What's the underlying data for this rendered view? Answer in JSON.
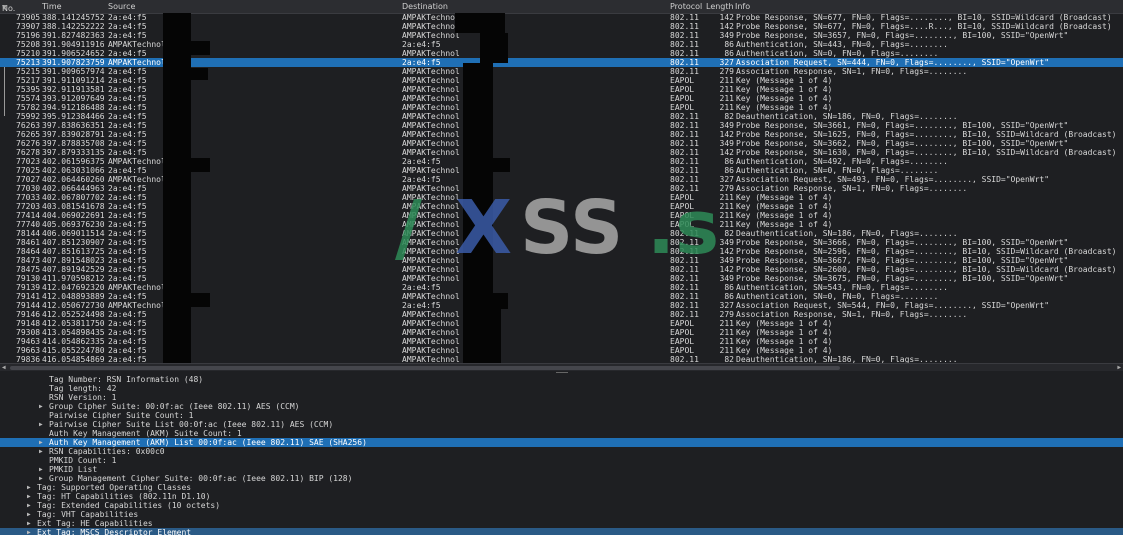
{
  "columns": [
    {
      "key": "no",
      "label": "No."
    },
    {
      "key": "time",
      "label": "Time"
    },
    {
      "key": "source",
      "label": "Source"
    },
    {
      "key": "destination",
      "label": "Destination"
    },
    {
      "key": "protocol",
      "label": "Protocol"
    },
    {
      "key": "length",
      "label": "Length"
    },
    {
      "key": "info",
      "label": "Info"
    }
  ],
  "selected_packet_index": 5,
  "packets": [
    {
      "no": "73905",
      "time": "388.141245752",
      "source": "2a:e4:f5",
      "destination": "AMPAKTechnol",
      "protocol": "802.11",
      "length": "142",
      "info": "Probe Response, SN=677, FN=0, Flags=........, BI=10, SSID=Wildcard (Broadcast)"
    },
    {
      "no": "73907",
      "time": "388.142252222",
      "source": "2a:e4:f5",
      "destination": "AMPAKTechnol",
      "protocol": "802.11",
      "length": "142",
      "info": "Probe Response, SN=677, FN=0, Flags=....R..., BI=10, SSID=Wildcard (Broadcast)"
    },
    {
      "no": "75196",
      "time": "391.827482363",
      "source": "2a:e4:f5",
      "destination": "AMPAKTechnol",
      "protocol": "802.11",
      "length": "349",
      "info": "Probe Response, SN=3657, FN=0, Flags=........, BI=100, SSID=\"OpenWrt\""
    },
    {
      "no": "75208",
      "time": "391.904911916",
      "source": "AMPAKTechnol",
      "destination": "2a:e4:f5",
      "protocol": "802.11",
      "length": "86",
      "info": "Authentication, SN=443, FN=0, Flags=........"
    },
    {
      "no": "75210",
      "time": "391.906524652",
      "source": "2a:e4:f5",
      "destination": "AMPAKTechnol",
      "protocol": "802.11",
      "length": "86",
      "info": "Authentication, SN=0, FN=0, Flags=........"
    },
    {
      "no": "75213",
      "time": "391.907823759",
      "source": "AMPAKTechnol",
      "destination": "2a:e4:f5",
      "protocol": "802.11",
      "length": "327",
      "info": "Association Request, SN=444, FN=0, Flags=........, SSID=\"OpenWrt\""
    },
    {
      "no": "75215",
      "time": "391.909657974",
      "source": "2a:e4:f5",
      "destination": "AMPAKTechnol",
      "protocol": "802.11",
      "length": "279",
      "info": "Association Response, SN=1, FN=0, Flags=........"
    },
    {
      "no": "75217",
      "time": "391.911091214",
      "source": "2a:e4:f5",
      "destination": "AMPAKTechnol",
      "protocol": "EAPOL",
      "length": "211",
      "info": "Key (Message 1 of 4)"
    },
    {
      "no": "75395",
      "time": "392.911913581",
      "source": "2a:e4:f5",
      "destination": "AMPAKTechnol",
      "protocol": "EAPOL",
      "length": "211",
      "info": "Key (Message 1 of 4)"
    },
    {
      "no": "75574",
      "time": "393.912097649",
      "source": "2a:e4:f5",
      "destination": "AMPAKTechnol",
      "protocol": "EAPOL",
      "length": "211",
      "info": "Key (Message 1 of 4)"
    },
    {
      "no": "75782",
      "time": "394.912186488",
      "source": "2a:e4:f5",
      "destination": "AMPAKTechnol",
      "protocol": "EAPOL",
      "length": "211",
      "info": "Key (Message 1 of 4)"
    },
    {
      "no": "75992",
      "time": "395.912384466",
      "source": "2a:e4:f5",
      "destination": "AMPAKTechnol",
      "protocol": "802.11",
      "length": "82",
      "info": "Deauthentication, SN=186, FN=0, Flags=........"
    },
    {
      "no": "76263",
      "time": "397.838636351",
      "source": "2a:e4:f5",
      "destination": "AMPAKTechnol",
      "protocol": "802.11",
      "length": "349",
      "info": "Probe Response, SN=3661, FN=0, Flags=........, BI=100, SSID=\"OpenWrt\""
    },
    {
      "no": "76265",
      "time": "397.839028791",
      "source": "2a:e4:f5",
      "destination": "AMPAKTechnol",
      "protocol": "802.11",
      "length": "142",
      "info": "Probe Response, SN=1625, FN=0, Flags=........, BI=10, SSID=Wildcard (Broadcast)"
    },
    {
      "no": "76276",
      "time": "397.878835708",
      "source": "2a:e4:f5",
      "destination": "AMPAKTechnol",
      "protocol": "802.11",
      "length": "349",
      "info": "Probe Response, SN=3662, FN=0, Flags=........, BI=100, SSID=\"OpenWrt\""
    },
    {
      "no": "76278",
      "time": "397.879333135",
      "source": "2a:e4:f5",
      "destination": "AMPAKTechnol",
      "protocol": "802.11",
      "length": "142",
      "info": "Probe Response, SN=1630, FN=0, Flags=........, BI=10, SSID=Wildcard (Broadcast)"
    },
    {
      "no": "77023",
      "time": "402.061596375",
      "source": "AMPAKTechnol",
      "destination": "2a:e4:f5",
      "protocol": "802.11",
      "length": "86",
      "info": "Authentication, SN=492, FN=0, Flags=........"
    },
    {
      "no": "77025",
      "time": "402.063031066",
      "source": "2a:e4:f5",
      "destination": "AMPAKTechnol",
      "protocol": "802.11",
      "length": "86",
      "info": "Authentication, SN=0, FN=0, Flags=........"
    },
    {
      "no": "77027",
      "time": "402.064460260",
      "source": "AMPAKTechnol",
      "destination": "2a:e4:f5",
      "protocol": "802.11",
      "length": "327",
      "info": "Association Request, SN=493, FN=0, Flags=........, SSID=\"OpenWrt\""
    },
    {
      "no": "77030",
      "time": "402.066444963",
      "source": "2a:e4:f5",
      "destination": "AMPAKTechnol",
      "protocol": "802.11",
      "length": "279",
      "info": "Association Response, SN=1, FN=0, Flags=........"
    },
    {
      "no": "77033",
      "time": "402.067807702",
      "source": "2a:e4:f5",
      "destination": "AMPAKTechnol",
      "protocol": "EAPOL",
      "length": "211",
      "info": "Key (Message 1 of 4)"
    },
    {
      "no": "77203",
      "time": "403.081541678",
      "source": "2a:e4:f5",
      "destination": "AMPAKTechnol",
      "protocol": "EAPOL",
      "length": "211",
      "info": "Key (Message 1 of 4)"
    },
    {
      "no": "77414",
      "time": "404.069022691",
      "source": "2a:e4:f5",
      "destination": "AMPAKTechnol",
      "protocol": "EAPOL",
      "length": "211",
      "info": "Key (Message 1 of 4)"
    },
    {
      "no": "77740",
      "time": "405.069376230",
      "source": "2a:e4:f5",
      "destination": "AMPAKTechnol",
      "protocol": "EAPOL",
      "length": "211",
      "info": "Key (Message 1 of 4)"
    },
    {
      "no": "78144",
      "time": "406.069011514",
      "source": "2a:e4:f5",
      "destination": "AMPAKTechnol",
      "protocol": "802.11",
      "length": "82",
      "info": "Deauthentication, SN=186, FN=0, Flags=........"
    },
    {
      "no": "78461",
      "time": "407.851230907",
      "source": "2a:e4:f5",
      "destination": "AMPAKTechnol",
      "protocol": "802.11",
      "length": "349",
      "info": "Probe Response, SN=3666, FN=0, Flags=........, BI=100, SSID=\"OpenWrt\""
    },
    {
      "no": "78464",
      "time": "407.851613725",
      "source": "2a:e4:f5",
      "destination": "AMPAKTechnol",
      "protocol": "802.11",
      "length": "142",
      "info": "Probe Response, SN=2596, FN=0, Flags=........, BI=10, SSID=Wildcard (Broadcast)"
    },
    {
      "no": "78473",
      "time": "407.891548023",
      "source": "2a:e4:f5",
      "destination": "AMPAKTechnol",
      "protocol": "802.11",
      "length": "349",
      "info": "Probe Response, SN=3667, FN=0, Flags=........, BI=100, SSID=\"OpenWrt\""
    },
    {
      "no": "78475",
      "time": "407.891942529",
      "source": "2a:e4:f5",
      "destination": "AMPAKTechnol",
      "protocol": "802.11",
      "length": "142",
      "info": "Probe Response, SN=2600, FN=0, Flags=........, BI=10, SSID=Wildcard (Broadcast)"
    },
    {
      "no": "79130",
      "time": "411.970598212",
      "source": "2a:e4:f5",
      "destination": "AMPAKTechnol",
      "protocol": "802.11",
      "length": "349",
      "info": "Probe Response, SN=3675, FN=0, Flags=........, BI=100, SSID=\"OpenWrt\""
    },
    {
      "no": "79139",
      "time": "412.047692320",
      "source": "AMPAKTechnol",
      "destination": "2a:e4:f5",
      "protocol": "802.11",
      "length": "86",
      "info": "Authentication, SN=543, FN=0, Flags=........"
    },
    {
      "no": "79141",
      "time": "412.048893889",
      "source": "2a:e4:f5",
      "destination": "AMPAKTechnol",
      "protocol": "802.11",
      "length": "86",
      "info": "Authentication, SN=0, FN=0, Flags=........"
    },
    {
      "no": "79144",
      "time": "412.050672730",
      "source": "AMPAKTechnol",
      "destination": "2a:e4:f5",
      "protocol": "802.11",
      "length": "327",
      "info": "Association Request, SN=544, FN=0, Flags=........, SSID=\"OpenWrt\""
    },
    {
      "no": "79146",
      "time": "412.052524498",
      "source": "2a:e4:f5",
      "destination": "AMPAKTechnol",
      "protocol": "802.11",
      "length": "279",
      "info": "Association Response, SN=1, FN=0, Flags=........"
    },
    {
      "no": "79148",
      "time": "412.053811750",
      "source": "2a:e4:f5",
      "destination": "AMPAKTechnol",
      "protocol": "EAPOL",
      "length": "211",
      "info": "Key (Message 1 of 4)"
    },
    {
      "no": "79308",
      "time": "413.054898435",
      "source": "2a:e4:f5",
      "destination": "AMPAKTechnol",
      "protocol": "EAPOL",
      "length": "211",
      "info": "Key (Message 1 of 4)"
    },
    {
      "no": "79463",
      "time": "414.054862335",
      "source": "2a:e4:f5",
      "destination": "AMPAKTechnol",
      "protocol": "EAPOL",
      "length": "211",
      "info": "Key (Message 1 of 4)"
    },
    {
      "no": "79663",
      "time": "415.055224780",
      "source": "2a:e4:f5",
      "destination": "AMPAKTechnol",
      "protocol": "EAPOL",
      "length": "211",
      "info": "Key (Message 1 of 4)"
    },
    {
      "no": "79836",
      "time": "416.054854869",
      "source": "2a:e4:f5",
      "destination": "AMPAKTechnol",
      "protocol": "802.11",
      "length": "82",
      "info": "Deauthentication, SN=186, FN=0, Flags=........"
    }
  ],
  "details": [
    {
      "text": "Tag Number: RSN Information (48)",
      "level": 2,
      "expandable": false,
      "state": ""
    },
    {
      "text": "Tag length: 42",
      "level": 2,
      "expandable": false,
      "state": ""
    },
    {
      "text": "RSN Version: 1",
      "level": 2,
      "expandable": false,
      "state": ""
    },
    {
      "text": "Group Cipher Suite: 00:0f:ac (Ieee 802.11) AES (CCM)",
      "level": 2,
      "expandable": true,
      "state": ""
    },
    {
      "text": "Pairwise Cipher Suite Count: 1",
      "level": 2,
      "expandable": false,
      "state": ""
    },
    {
      "text": "Pairwise Cipher Suite List 00:0f:ac (Ieee 802.11) AES (CCM)",
      "level": 2,
      "expandable": true,
      "state": ""
    },
    {
      "text": "Auth Key Management (AKM) Suite Count: 1",
      "level": 2,
      "expandable": false,
      "state": ""
    },
    {
      "text": "Auth Key Management (AKM) List 00:0f:ac (Ieee 802.11) SAE (SHA256)",
      "level": 2,
      "expandable": true,
      "state": "sel"
    },
    {
      "text": "RSN Capabilities: 0x00c0",
      "level": 2,
      "expandable": true,
      "state": ""
    },
    {
      "text": "PMKID Count: 1",
      "level": 2,
      "expandable": false,
      "state": ""
    },
    {
      "text": "PMKID List",
      "level": 2,
      "expandable": true,
      "state": ""
    },
    {
      "text": "Group Management Cipher Suite: 00:0f:ac (Ieee 802.11) BIP (128)",
      "level": 2,
      "expandable": true,
      "state": ""
    },
    {
      "text": "Tag: Supported Operating Classes",
      "level": 1,
      "expandable": true,
      "state": ""
    },
    {
      "text": "Tag: HT Capabilities (802.11n D1.10)",
      "level": 1,
      "expandable": true,
      "state": ""
    },
    {
      "text": "Tag: Extended Capabilities (10 octets)",
      "level": 1,
      "expandable": true,
      "state": ""
    },
    {
      "text": "Tag: VHT Capabilities",
      "level": 1,
      "expandable": true,
      "state": ""
    },
    {
      "text": "Ext Tag: HE Capabilities",
      "level": 1,
      "expandable": true,
      "state": ""
    },
    {
      "text": "Ext Tag: MSCS Descriptor Element",
      "level": 1,
      "expandable": true,
      "state": "sel2"
    }
  ],
  "watermark": {
    "parts": [
      {
        "text": "/",
        "color": "#2e8b57"
      },
      {
        "text": "X",
        "color": "#3b5ba8"
      },
      {
        "text": "SS",
        "color": "#a9a9a9"
      },
      {
        "text": ".s",
        "color": "#2e8b57"
      }
    ]
  },
  "colors": {
    "selected": "#1f6fb5",
    "selected_inactive": "#2a5a86",
    "background": "#1e1f22"
  },
  "icons": {
    "sort": "sort-desc-icon",
    "expand": "expand-triangle-icon"
  }
}
